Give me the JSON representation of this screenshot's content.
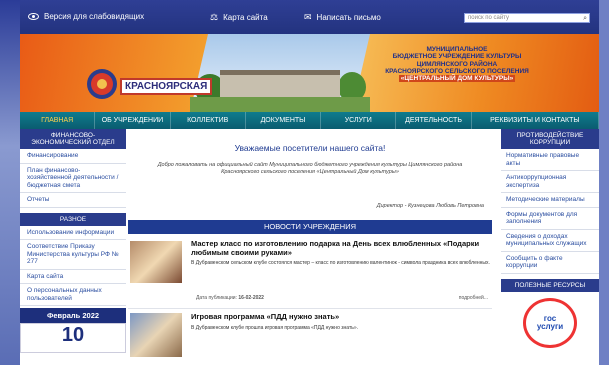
{
  "topbar": {
    "accessibility": "Версия для слабовидящих",
    "sitemap": "Карта сайта",
    "write": "Написать письмо",
    "search_placeholder": "поиск по сайту"
  },
  "banner": {
    "city": "КРАСНОЯРСКАЯ",
    "line1": "МУНИЦИПАЛЬНОЕ",
    "line2": "БЮДЖЕТНОЕ УЧРЕЖДЕНИЕ КУЛЬТУРЫ",
    "line3": "ЦИМЛЯНСКОГО РАЙОНА",
    "line4": "КРАСНОЯРСКОГО СЕЛЬСКОГО ПОСЕЛЕНИЯ",
    "line5": "«ЦЕНТРАЛЬНЫЙ ДОМ КУЛЬТУРЫ»"
  },
  "nav": [
    "ГЛАВНАЯ",
    "ОБ УЧРЕЖДЕНИИ",
    "КОЛЛЕКТИВ",
    "ДОКУМЕНТЫ",
    "УСЛУГИ",
    "ДЕЯТЕЛЬНОСТЬ",
    "РЕКВИЗИТЫ И КОНТАКТЫ"
  ],
  "left": {
    "head1": "ФИНАНСОВО-ЭКОНОМИЧЕСКИЙ ОТДЕЛ",
    "items1": [
      "Финансирование",
      "План финансово-хозяйственной деятельности / бюджетная смета",
      "Отчеты"
    ],
    "head2": "РАЗНОЕ",
    "items2": [
      "Использование информации",
      "Соответствие Приказу Министерства культуры РФ № 277",
      "Карта сайта",
      "О персональных данных пользователей"
    ],
    "month": "Февраль 2022",
    "day": "10"
  },
  "main": {
    "welcome": "Уважаемые посетители нашего сайта!",
    "text": "Добро пожаловать на официальный сайт Муниципального бюджетного учреждения культуры Цимлянского района Красноярского сельского поселения «Центральный Дом культуры»",
    "director": "Директор - Кузнецова Любовь Петровна",
    "news_header": "НОВОСТИ УЧРЕЖДЕНИЯ",
    "news": [
      {
        "title": "Мастер класс по изготовлению подарка на День всех влюбленных «Подарки любимым своими руками»",
        "body": "В Дубравенском сельском клубе состоялся мастер – класс по изготовлению валентинок - символа праздника всех влюбленных.",
        "date_label": "Дата публикации:",
        "date": "16-02-2022",
        "more": "подробней..."
      },
      {
        "title": "Игровая программа «ПДД нужно знать»",
        "body": "В Дубравенском клубе прошла игровая программа «ПДД нужно знать»."
      }
    ]
  },
  "right": {
    "head1": "ПРОТИВОДЕЙСТВИЕ КОРРУПЦИИ",
    "items": [
      "Нормативные правовые акты",
      "Антикоррупционная экспертиза",
      "Методические материалы",
      "Формы документов для заполнения",
      "Сведения о доходах муниципальных служащих",
      "Сообщить о факте коррупции"
    ],
    "head2": "ПОЛЕЗНЫЕ РЕСУРСЫ",
    "gos1": "гос",
    "gos2": "услуги"
  }
}
